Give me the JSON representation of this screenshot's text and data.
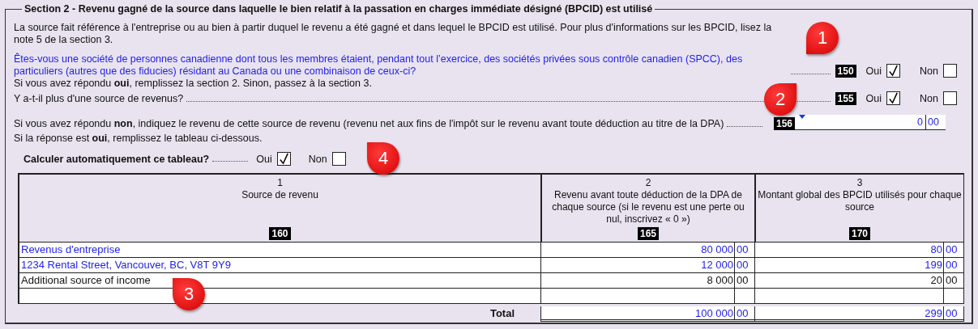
{
  "section": {
    "title": "Section 2 - Revenu gagné de la source dans laquelle le bien relatif à la passation en charges immédiate désigné (BPCID) est utilisé",
    "intro": "La source fait référence à l'entreprise ou au bien à partir duquel le revenu a été gagné et dans lequel le BPCID est utilisé. Pour plus d'informations sur les BPCID, lisez la note 5 de la section 3.",
    "lines": [
      {
        "kind": "yesno",
        "text": "Êtes-vous une société de personnes canadienne dont tous les membres étaient, pendant tout l’exercice, des sociétés privées sous contrôle canadien (SPCC), des particuliers (autres que des fiducies) résidant au Canada ou une combinaison de ceux-ci?",
        "blue": true,
        "code": "150",
        "yes": {
          "label": "Oui",
          "checked": true
        },
        "no": {
          "label": "Non",
          "checked": false
        }
      },
      {
        "kind": "note",
        "text": "Si vous avez répondu **oui**, remplissez la section 2. Sinon, passez à la section 3."
      },
      {
        "kind": "yesno",
        "text": "Y a-t-il plus d'une source de revenus?",
        "blue": false,
        "code": "155",
        "yes": {
          "label": "Oui",
          "checked": true
        },
        "no": {
          "label": "Non",
          "checked": false
        }
      },
      {
        "kind": "amount",
        "text": "Si vous avez répondu **non**, indiquez le revenu de cette source de revenu (revenu net aux fins de l'impôt sur le revenu avant toute déduction au titre de la DPA)",
        "code": "156",
        "value": "0",
        "cents": "00"
      },
      {
        "kind": "note",
        "text": "Si la réponse est **oui**, remplissez le tableau ci-dessous."
      }
    ],
    "auto_calc": {
      "label": "Calculer automatiquement ce tableau?",
      "yes": {
        "label": "Oui",
        "checked": true
      },
      "no": {
        "label": "Non",
        "checked": false
      }
    },
    "table": {
      "columns": [
        {
          "number": "1",
          "title": "Source de revenu",
          "code": "160"
        },
        {
          "number": "2",
          "title": "Revenu avant toute déduction de la DPA de chaque source (si le revenu est une perte ou nul, inscrivez « 0 »)",
          "code": "165"
        },
        {
          "number": "3",
          "title": "Montant global des BPCID utilisés pour chaque source",
          "code": "170"
        }
      ],
      "rows": [
        {
          "source": "Revenus d'entreprise",
          "entered": true,
          "income": "80 000",
          "income_cents": "00",
          "amount": "80",
          "amount_cents": "00"
        },
        {
          "source": "1234 Rental Street, Vancouver, BC, V8T 9Y9",
          "entered": true,
          "income": "12 000",
          "income_cents": "00",
          "amount": "199",
          "amount_cents": "00"
        },
        {
          "source": "Additional source of income",
          "entered": false,
          "income": "8 000",
          "income_cents": "00",
          "amount": "20",
          "amount_cents": "00"
        },
        {
          "blank": true
        }
      ],
      "total": {
        "label": "Total",
        "income": "100 000",
        "income_cents": "00",
        "amount": "299",
        "amount_cents": "00"
      }
    }
  },
  "callouts": [
    "1",
    "2",
    "3",
    "4"
  ]
}
